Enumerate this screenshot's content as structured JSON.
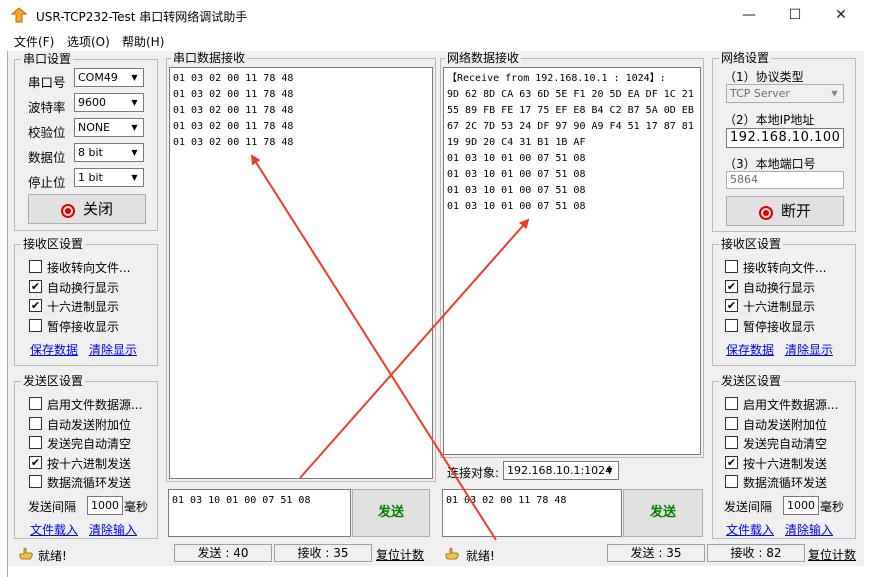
{
  "window": {
    "title": "USR-TCP232-Test 串口转网络调试助手",
    "minimize": "—",
    "maximize": "☐",
    "close": "✕"
  },
  "menu": [
    "文件(F)",
    "选项(O)",
    "帮助(H)"
  ],
  "serial_settings": {
    "title": "串口设置",
    "port_label": "串口号",
    "port_value": "COM49",
    "baud_label": "波特率",
    "baud_value": "9600",
    "parity_label": "校验位",
    "parity_value": "NONE",
    "databits_label": "数据位",
    "databits_value": "8 bit",
    "stopbits_label": "停止位",
    "stopbits_value": "1 bit",
    "close_button": "关闭"
  },
  "serial_receive_settings": {
    "title": "接收区设置",
    "options": [
      {
        "label": "接收转向文件...",
        "checked": false
      },
      {
        "label": "自动换行显示",
        "checked": true
      },
      {
        "label": "十六进制显示",
        "checked": true
      },
      {
        "label": "暂停接收显示",
        "checked": false
      }
    ],
    "save_link": "保存数据",
    "clear_link": "清除显示"
  },
  "serial_send_settings": {
    "title": "发送区设置",
    "options": [
      {
        "label": "启用文件数据源...",
        "checked": false
      },
      {
        "label": "自动发送附加位",
        "checked": false
      },
      {
        "label": "发送完自动清空",
        "checked": false
      },
      {
        "label": "按十六进制发送",
        "checked": true
      },
      {
        "label": "数据流循环发送",
        "checked": false
      }
    ],
    "interval_label": "发送间隔",
    "interval_value": "1000",
    "interval_unit": "毫秒",
    "load_link": "文件载入",
    "clear_link": "清除输入"
  },
  "serial_receive": {
    "title": "串口数据接收",
    "lines": [
      "01 03 02 00 11 78 48",
      "01 03 02 00 11 78 48",
      "01 03 02 00 11 78 48",
      "01 03 02 00 11 78 48",
      "01 03 02 00 11 78 48"
    ]
  },
  "serial_send": {
    "input": "01 03 10 01 00 07 51 08",
    "button": "发送"
  },
  "net_receive": {
    "title": "网络数据接收",
    "lines": [
      "【Receive from 192.168.10.1 : 1024】:",
      "9D 62 8D CA 63 6D 5E F1 20 5D EA DF 1C 21",
      "55 89 FB FE 17 75 EF E8 B4 C2 B7 5A 0D EB",
      "67 2C 7D 53 24 DF 97 90 A9 F4 51 17 87 81",
      "19 9D 20 C4 31 B1 1B AF",
      "01 03 10 01 00 07 51 08",
      "01 03 10 01 00 07 51 08",
      "01 03 10 01 00 07 51 08",
      "01 03 10 01 00 07 51 08"
    ],
    "target_label": "连接对象:",
    "target_value": "192.168.10.1:1024"
  },
  "net_send": {
    "input": "01 03 02 00 11 78 48",
    "button": "发送"
  },
  "net_settings": {
    "title": "网络设置",
    "protocol_label": "（1）协议类型",
    "protocol_value": "TCP Server",
    "ip_label": "（2）本地IP地址",
    "ip_value": "192.168.10.100",
    "port_label": "（3）本地端口号",
    "port_value": "5864",
    "disconnect_button": "断开"
  },
  "net_receive_settings": {
    "title": "接收区设置",
    "options": [
      {
        "label": "接收转向文件...",
        "checked": false
      },
      {
        "label": "自动换行显示",
        "checked": true
      },
      {
        "label": "十六进制显示",
        "checked": true
      },
      {
        "label": "暂停接收显示",
        "checked": false
      }
    ],
    "save_link": "保存数据",
    "clear_link": "清除显示"
  },
  "net_send_settings": {
    "title": "发送区设置",
    "options": [
      {
        "label": "启用文件数据源...",
        "checked": false
      },
      {
        "label": "自动发送附加位",
        "checked": false
      },
      {
        "label": "发送完自动清空",
        "checked": false
      },
      {
        "label": "按十六进制发送",
        "checked": true
      },
      {
        "label": "数据流循环发送",
        "checked": false
      }
    ],
    "interval_label": "发送间隔",
    "interval_value": "1000",
    "interval_unit": "毫秒",
    "load_link": "文件载入",
    "clear_link": "清除输入"
  },
  "status_left": {
    "ready": "就绪!",
    "sent": "发送 : 40",
    "received": "接收 : 35",
    "reset": "复位计数"
  },
  "status_right": {
    "ready": "就绪!",
    "sent": "发送 : 35",
    "received": "接收 : 82",
    "reset": "复位计数"
  },
  "colors": {
    "arrow": "#f03c2c",
    "send_text": "#008000",
    "link": "#0000ee",
    "indicator": "#e00000"
  }
}
